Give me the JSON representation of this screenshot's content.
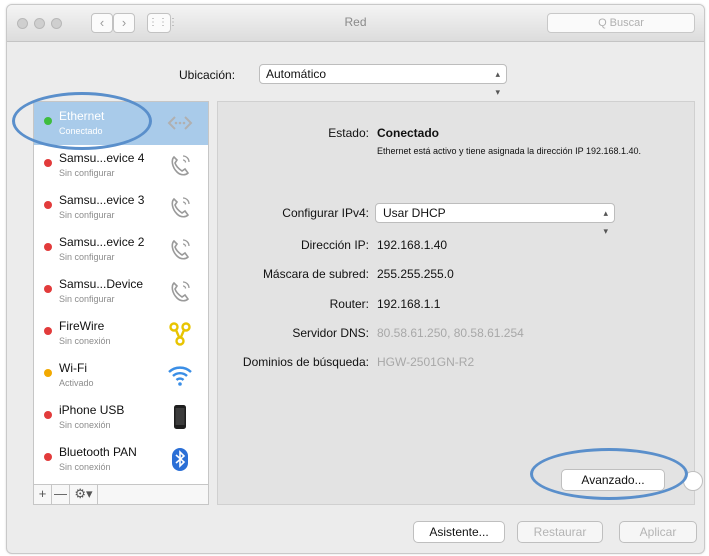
{
  "window": {
    "title": "Red",
    "search_placeholder": "Q Buscar"
  },
  "location": {
    "label": "Ubicación:",
    "value": "Automático"
  },
  "services": [
    {
      "name": "Ethernet",
      "status": "Conectado",
      "dot_color": "#3ebd3e",
      "icon": "ethernet-arrows-icon",
      "selected": true
    },
    {
      "name": "Samsu...evice 4",
      "status": "Sin configurar",
      "dot_color": "#e23b3b",
      "icon": "phone-handset-icon"
    },
    {
      "name": "Samsu...evice 3",
      "status": "Sin configurar",
      "dot_color": "#e23b3b",
      "icon": "phone-handset-icon"
    },
    {
      "name": "Samsu...evice 2",
      "status": "Sin configurar",
      "dot_color": "#e23b3b",
      "icon": "phone-handset-icon"
    },
    {
      "name": "Samsu...Device",
      "status": "Sin configurar",
      "dot_color": "#e23b3b",
      "icon": "phone-handset-icon"
    },
    {
      "name": "FireWire",
      "status": "Sin conexión",
      "dot_color": "#e23b3b",
      "icon": "firewire-icon"
    },
    {
      "name": "Wi-Fi",
      "status": "Activado",
      "dot_color": "#f2a900",
      "icon": "wifi-icon"
    },
    {
      "name": "iPhone USB",
      "status": "Sin conexión",
      "dot_color": "#e23b3b",
      "icon": "iphone-icon"
    },
    {
      "name": "Bluetooth PAN",
      "status": "Sin conexión",
      "dot_color": "#e23b3b",
      "icon": "bluetooth-icon"
    }
  ],
  "sidebar_controls": {
    "add": "+",
    "remove": "—",
    "action": "⚙▾"
  },
  "details": {
    "status_label": "Estado:",
    "status_value": "Conectado",
    "status_desc": "Ethernet está activo y tiene asignada la dirección IP 192.168.1.40.",
    "ipv4_label": "Configurar IPv4:",
    "ipv4_value": "Usar DHCP",
    "ip_label": "Dirección IP:",
    "ip_value": "192.168.1.40",
    "mask_label": "Máscara de subred:",
    "mask_value": "255.255.255.0",
    "router_label": "Router:",
    "router_value": "192.168.1.1",
    "dns_label": "Servidor DNS:",
    "dns_value": "80.58.61.250, 80.58.61.254",
    "domains_label": "Dominios de búsqueda:",
    "domains_value": "HGW-2501GN-R2"
  },
  "buttons": {
    "advanced": "Avanzado...",
    "assistant": "Asistente...",
    "revert": "Restaurar",
    "apply": "Aplicar"
  },
  "colors": {
    "accent_selection": "#a9cbea",
    "annotation": "#5a8fcb"
  }
}
